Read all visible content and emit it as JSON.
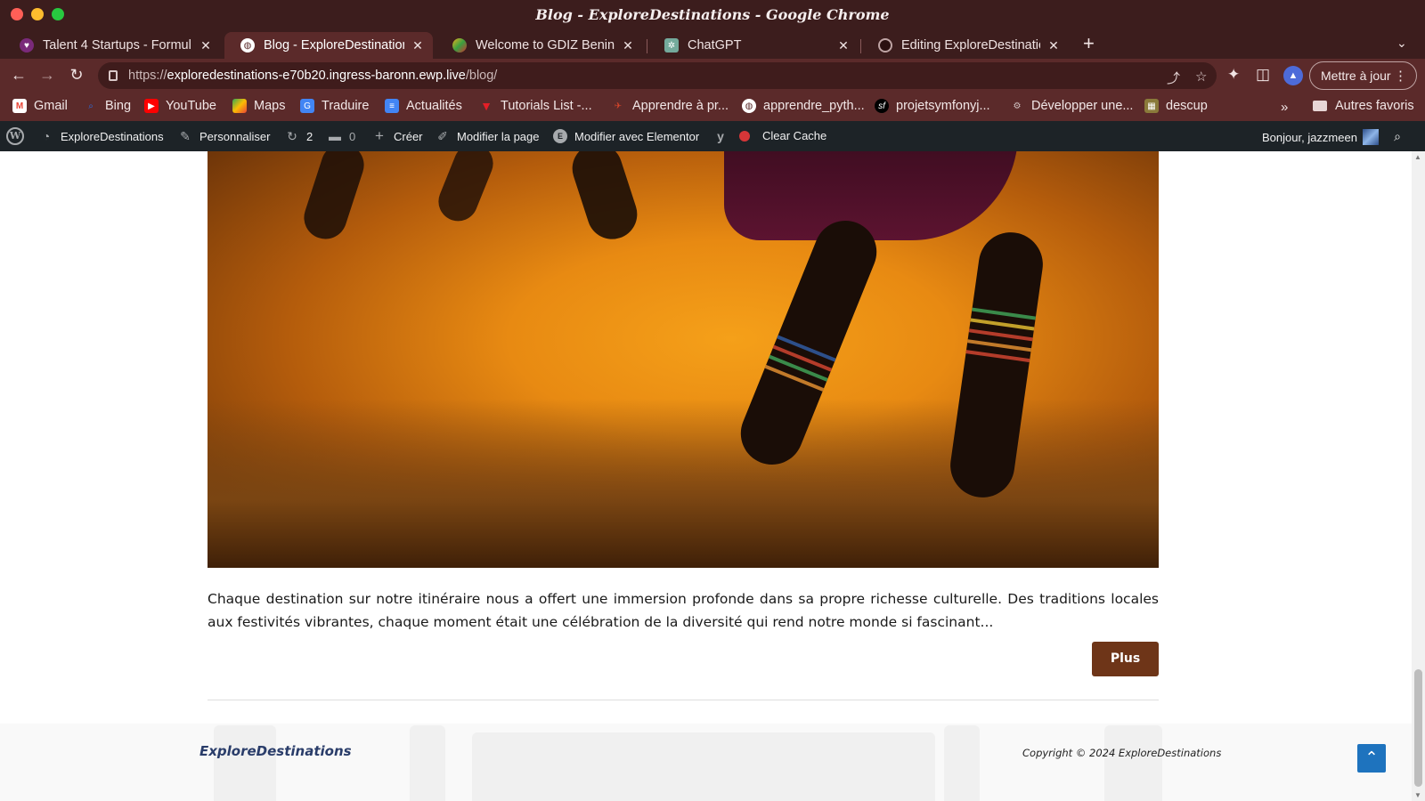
{
  "window": {
    "title": "Blog - ExploreDestinations - Google Chrome"
  },
  "tabs": [
    {
      "label": "Talent 4 Startups - Formul",
      "icon": "heart-icon",
      "active": false
    },
    {
      "label": "Blog - ExploreDestination",
      "icon": "globe-icon",
      "active": true
    },
    {
      "label": "Welcome to GDIZ Benin",
      "icon": "gdiz-icon",
      "active": false
    },
    {
      "label": "ChatGPT",
      "icon": "chatgpt-icon",
      "active": false
    },
    {
      "label": "Editing ExploreDestination",
      "icon": "github-icon",
      "active": false
    }
  ],
  "toolbar": {
    "url_prefix": "https://",
    "url_host": "exploredestinations-e70b20.ingress-baronn.ewp.live",
    "url_path": "/blog/",
    "update_label": "Mettre à jour"
  },
  "bookmarks": {
    "items": [
      {
        "label": "Gmail",
        "icon": "gmail-icon",
        "color": "#ea4335"
      },
      {
        "label": "Bing",
        "icon": "search-icon",
        "color": "#2b6de0"
      },
      {
        "label": "YouTube",
        "icon": "youtube-icon",
        "color": "#ff0000"
      },
      {
        "label": "Maps",
        "icon": "maps-icon",
        "color": "#34a853"
      },
      {
        "label": "Traduire",
        "icon": "translate-icon",
        "color": "#4285f4"
      },
      {
        "label": "Actualités",
        "icon": "news-icon",
        "color": "#4285f4"
      },
      {
        "label": "Tutorials List -...",
        "icon": "tutorials-icon",
        "color": "#e41e26"
      },
      {
        "label": "Apprendre à pr...",
        "icon": "apprendre-icon",
        "color": "#d4452a"
      },
      {
        "label": "apprendre_pyth...",
        "icon": "globe-icon",
        "color": "#555555"
      },
      {
        "label": "projetsymfonyj...",
        "icon": "symfony-icon",
        "color": "#000000"
      },
      {
        "label": "Développer une...",
        "icon": "developper-icon",
        "color": "#555555"
      },
      {
        "label": "descup",
        "icon": "descup-icon",
        "color": "#8a7a3a"
      }
    ],
    "other_label": "Autres favoris"
  },
  "adminbar": {
    "site_name": "ExploreDestinations",
    "customize": "Personnaliser",
    "updates_count": "2",
    "comments_count": "0",
    "create": "Créer",
    "edit_page": "Modifier la page",
    "elementor": "Modifier avec Elementor",
    "clear_cache": "Clear Cache",
    "greeting": "Bonjour, jazzmeen"
  },
  "post": {
    "excerpt": "Chaque destination sur notre itinéraire nous a offert une immersion profonde dans sa propre richesse culturelle. Des traditions locales aux festivités vibrantes, chaque moment était une célébration de la diversité qui rend notre monde si fascinant...",
    "more_label": "Plus"
  },
  "footer": {
    "brand": "ExploreDestinations",
    "copyright": "Copyright © 2024 ExploreDestinations"
  },
  "colors": {
    "chrome_frame": "#3c1d1d",
    "chrome_toolbar": "#5b2a2a",
    "wp_adminbar": "#1d2327",
    "more_button": "#6e3518",
    "brand_text": "#2a3d6a",
    "back_to_top": "#1e73be"
  }
}
